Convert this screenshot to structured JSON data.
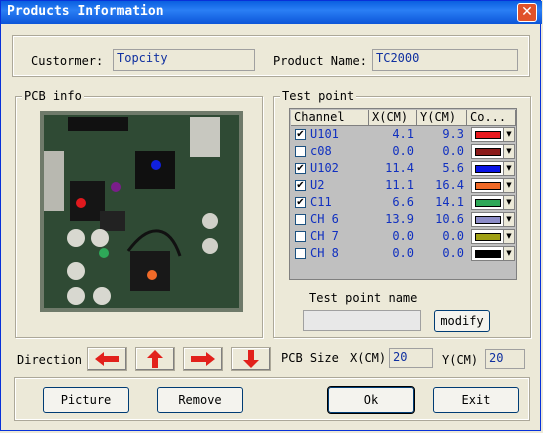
{
  "window": {
    "title": "Products Information",
    "close": "✕"
  },
  "customer": {
    "label": "Custormer:",
    "value": "Topcity"
  },
  "product": {
    "label": "Product Name:",
    "value": "TC2000"
  },
  "pcb_info": {
    "label": "PCB info"
  },
  "test_point": {
    "label": "Test point",
    "columns": [
      "Channel",
      "X(CM)",
      "Y(CM)",
      "Co..."
    ],
    "rows": [
      {
        "checked": true,
        "channel": "U101",
        "x": "4.1",
        "y": "9.3",
        "color": "#E8191E"
      },
      {
        "checked": false,
        "channel": "c08",
        "x": "0.0",
        "y": "0.0",
        "color": "#8B1A1A"
      },
      {
        "checked": true,
        "channel": "U102",
        "x": "11.4",
        "y": "5.6",
        "color": "#0A14E6"
      },
      {
        "checked": true,
        "channel": "U2",
        "x": "11.1",
        "y": "16.4",
        "color": "#F06A28"
      },
      {
        "checked": true,
        "channel": "C11",
        "x": "6.6",
        "y": "14.1",
        "color": "#2EA858"
      },
      {
        "checked": false,
        "channel": "CH 6",
        "x": "13.9",
        "y": "10.6",
        "color": "#8C8CC8"
      },
      {
        "checked": false,
        "channel": "CH 7",
        "x": "0.0",
        "y": "0.0",
        "color": "#A0A014"
      },
      {
        "checked": false,
        "channel": "CH 8",
        "x": "0.0",
        "y": "0.0",
        "color": "#000000"
      }
    ],
    "name_label": "Test point name",
    "name_value": "",
    "modify": "modify"
  },
  "direction": {
    "label": "Direction"
  },
  "pcb_size": {
    "label": "PCB Size",
    "x_label": "X(CM)",
    "x_value": "20",
    "y_label": "Y(CM)",
    "y_value": "20"
  },
  "buttons": {
    "picture": "Picture",
    "remove": "Remove",
    "ok": "Ok",
    "exit": "Exit"
  },
  "colors": {
    "title_bar": "#0A5FE0",
    "dialog_bg": "#ECE9D8",
    "value_text": "#1030A0"
  }
}
